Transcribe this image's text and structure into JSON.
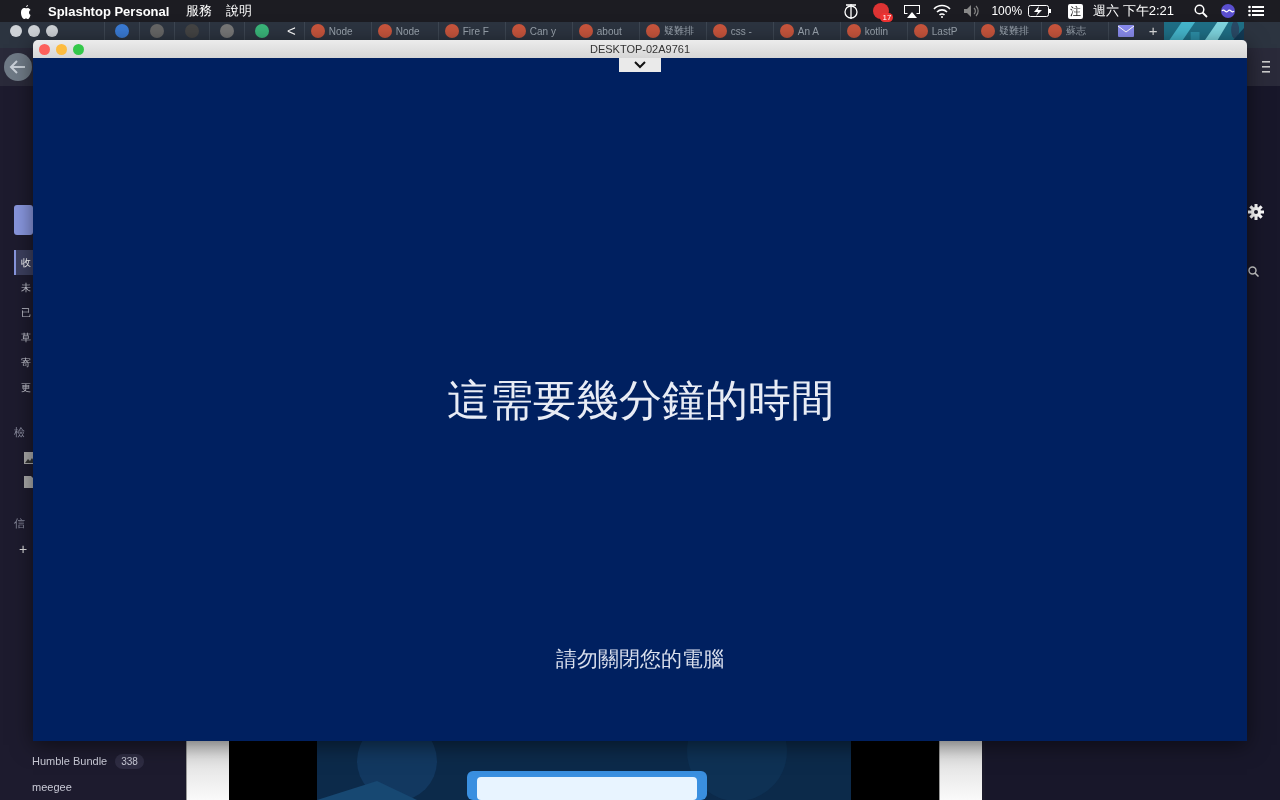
{
  "menu_bar": {
    "app_name": "Splashtop Personal",
    "menus": [
      "服務",
      "說明"
    ],
    "notification_count": "17",
    "battery": "100%",
    "input_method": "注",
    "clock": "週六 下午2:21"
  },
  "browser": {
    "scroll_left": "<",
    "tabs": [
      {
        "label": "Node"
      },
      {
        "label": "Node"
      },
      {
        "label": "Fire F"
      },
      {
        "label": "Can y"
      },
      {
        "label": "about"
      },
      {
        "label": "疑難排"
      },
      {
        "label": "css -"
      },
      {
        "label": "An A"
      },
      {
        "label": "kotlin"
      },
      {
        "label": "LastP"
      },
      {
        "label": "疑難排"
      },
      {
        "label": "蘇志"
      }
    ],
    "new_tab": "+"
  },
  "sidebar": {
    "folders": [
      {
        "label": "收",
        "selected": true
      },
      {
        "label": "未",
        "selected": false
      },
      {
        "label": "已",
        "selected": false
      },
      {
        "label": "草",
        "selected": false
      },
      {
        "label": "寄",
        "selected": false
      },
      {
        "label": "更",
        "selected": false
      }
    ],
    "views_heading": "檢",
    "mail_heading": "信",
    "add": "+",
    "labels": [
      {
        "label": "Humble Bundle",
        "count": "338"
      },
      {
        "label": "meegee"
      }
    ]
  },
  "remote_window": {
    "title": "DESKTOP-02A9761",
    "message": "這需要幾分鐘的時間",
    "note": "請勿關閉您的電腦"
  }
}
